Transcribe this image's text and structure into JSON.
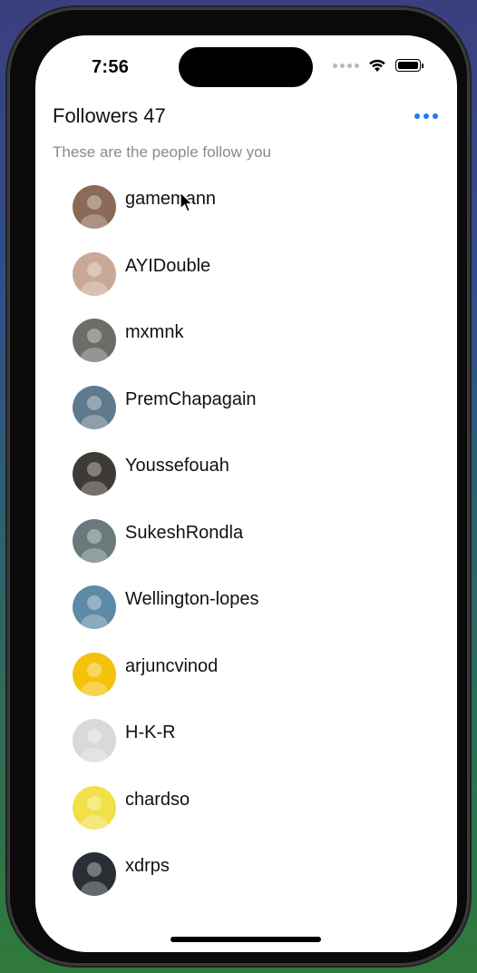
{
  "status_bar": {
    "time": "7:56"
  },
  "header": {
    "title": "Followers 47",
    "subtitle": "These are the people follow you",
    "more_icon": "ellipsis-icon"
  },
  "followers": [
    {
      "username": "gamemann",
      "avatar_color": "#8a6a58"
    },
    {
      "username": "AYIDouble",
      "avatar_color": "#c9a995"
    },
    {
      "username": "mxmnk",
      "avatar_color": "#6c6c68"
    },
    {
      "username": "PremChapagain",
      "avatar_color": "#5f7a8c"
    },
    {
      "username": "Youssefouah",
      "avatar_color": "#3e3a36"
    },
    {
      "username": "SukeshRondla",
      "avatar_color": "#6a7a7c"
    },
    {
      "username": "Wellington-lopes",
      "avatar_color": "#5d8aa6"
    },
    {
      "username": "arjuncvinod",
      "avatar_color": "#f4c20d"
    },
    {
      "username": "H-K-R",
      "avatar_color": "#d9d9d9"
    },
    {
      "username": "chardso",
      "avatar_color": "#f2e04a"
    },
    {
      "username": "xdrps",
      "avatar_color": "#2a2f35"
    }
  ],
  "colors": {
    "accent": "#1a7cf0",
    "text": "#111111",
    "secondary_text": "#8a8a8e"
  }
}
